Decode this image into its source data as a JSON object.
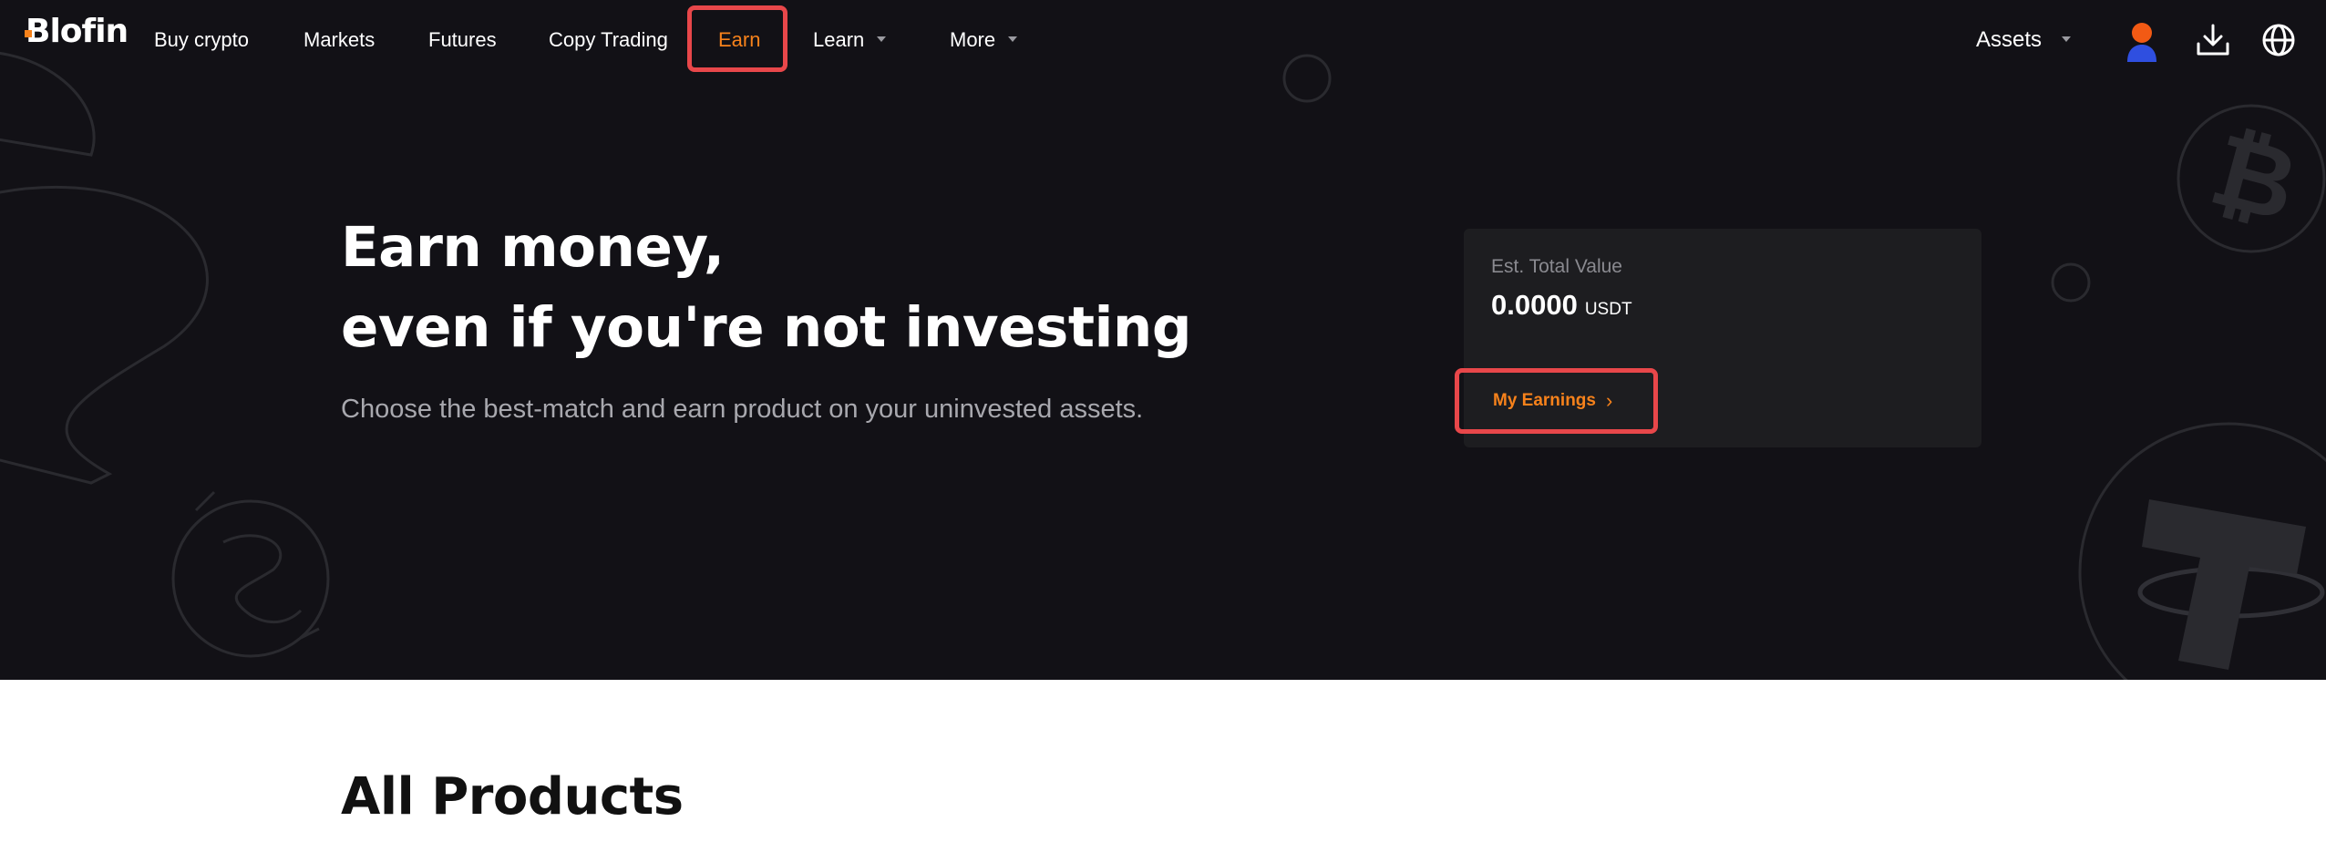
{
  "brand": {
    "logo_text": "Blofin",
    "accent_color": "#f7821b",
    "highlight_color": "#e8474a",
    "hero_bg": "#121116"
  },
  "nav": {
    "items": [
      {
        "label": "Buy crypto"
      },
      {
        "label": "Markets"
      },
      {
        "label": "Futures"
      },
      {
        "label": "Copy Trading"
      },
      {
        "label": "Earn",
        "active": true
      },
      {
        "label": "Learn",
        "has_dropdown": true
      },
      {
        "label": "More",
        "has_dropdown": true
      }
    ],
    "assets_label": "Assets",
    "icons": [
      "avatar-icon",
      "download-icon",
      "globe-icon"
    ]
  },
  "hero": {
    "title_line1": "Earn money,",
    "title_line2": "even if you're not investing",
    "subtitle": "Choose the best-match and earn product on your uninvested assets."
  },
  "summary_card": {
    "label": "Est. Total Value",
    "value": "0.0000",
    "unit": "USDT",
    "button_label": "My Earnings"
  },
  "products": {
    "title": "All Products"
  }
}
